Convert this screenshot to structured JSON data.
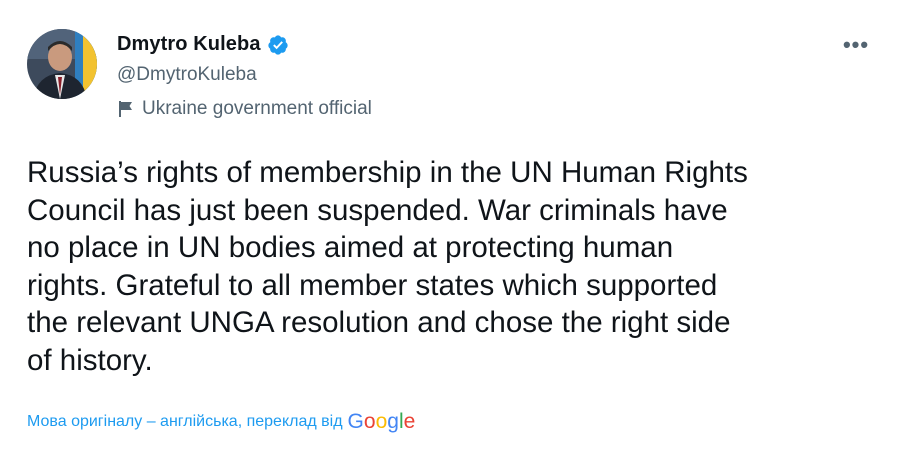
{
  "author": {
    "display_name": "Dmytro Kuleba",
    "handle": "@DmytroKuleba",
    "label": "Ukraine government official",
    "verified": true,
    "avatar_icon": "profile-photo"
  },
  "menu": {
    "more_label": "•••"
  },
  "tweet": {
    "lines": [
      "Russia’s rights of membership in the UN Human Rights",
      "Council has just been suspended. War criminals have",
      "no place in UN bodies aimed at protecting human",
      "rights. Grateful to all member states which supported",
      "the relevant UNGA resolution and chose the right side",
      "of history."
    ]
  },
  "translation": {
    "notice": "Мова оригіналу – англійська, переклад від",
    "provider": "Google"
  },
  "colors": {
    "link": "#1d9bf0",
    "secondary_text": "#536471",
    "primary_text": "#0f1419",
    "verified_badge": "#1d9bf0"
  }
}
